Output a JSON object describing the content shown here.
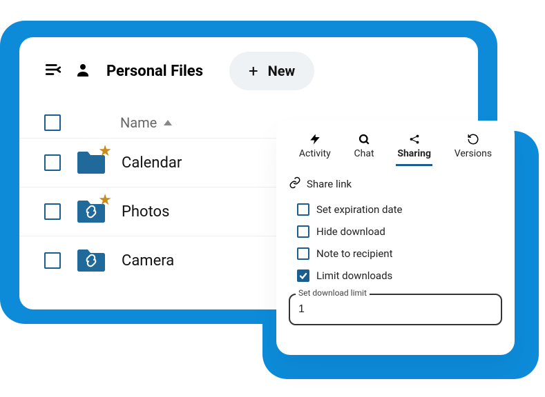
{
  "header": {
    "title": "Personal Files",
    "new_label": "New"
  },
  "list": {
    "name_header": "Name",
    "rows": [
      {
        "name": "Calendar",
        "starred": true,
        "link": false
      },
      {
        "name": "Photos",
        "starred": true,
        "link": true
      },
      {
        "name": "Camera",
        "starred": false,
        "link": true
      }
    ]
  },
  "panel": {
    "tabs": {
      "activity": "Activity",
      "chat": "Chat",
      "sharing": "Sharing",
      "versions": "Versions"
    },
    "share_link": "Share link",
    "options": {
      "expiration": "Set expiration date",
      "hide_download": "Hide download",
      "note": "Note to recipient",
      "limit": "Limit downloads"
    },
    "limit_field": {
      "label": "Set download limit",
      "value": "1"
    }
  }
}
